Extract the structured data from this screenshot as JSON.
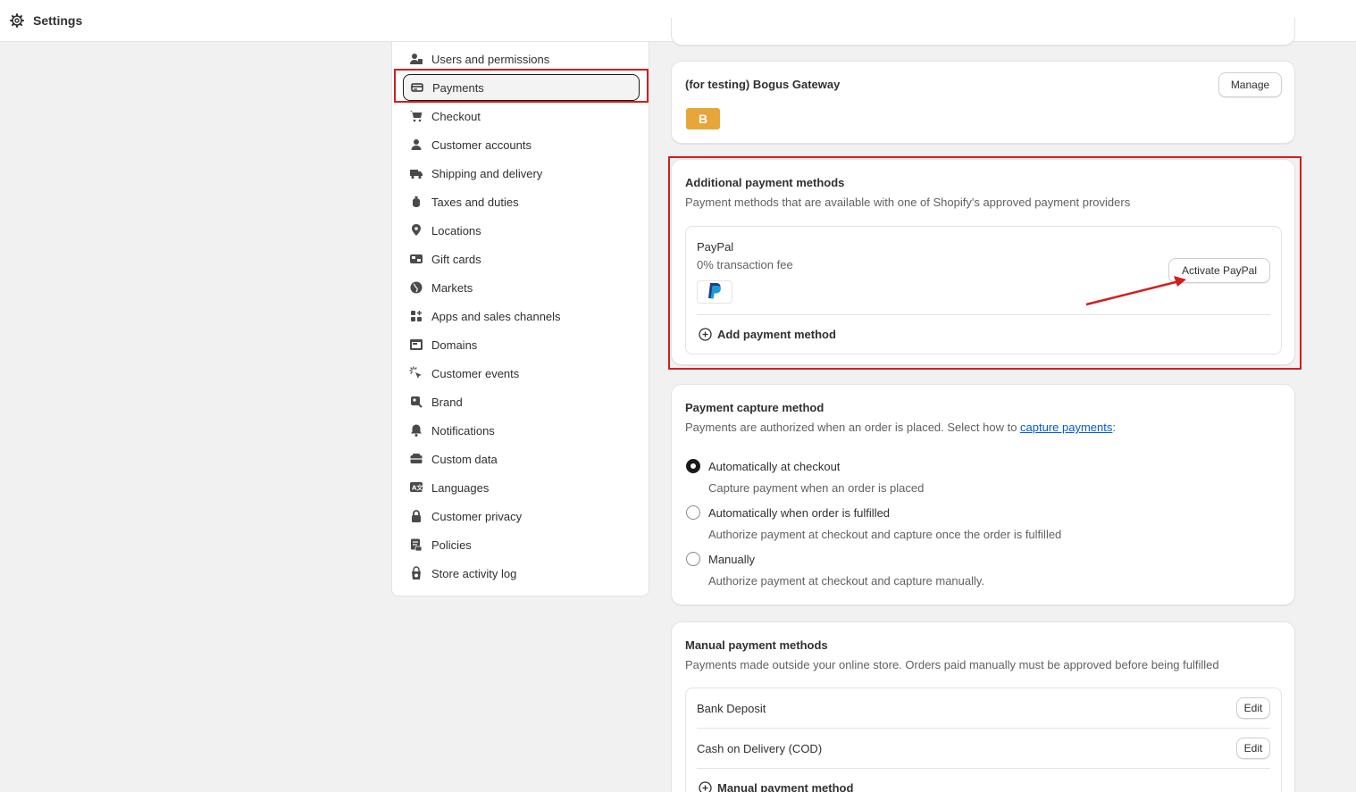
{
  "header": {
    "title": "Settings",
    "icon": "gear-icon"
  },
  "sidebar": {
    "items": [
      {
        "label": "Users and permissions",
        "icon": "users-icon"
      },
      {
        "label": "Payments",
        "icon": "payments-icon",
        "active": true
      },
      {
        "label": "Checkout",
        "icon": "cart-icon"
      },
      {
        "label": "Customer accounts",
        "icon": "person-icon"
      },
      {
        "label": "Shipping and delivery",
        "icon": "truck-icon"
      },
      {
        "label": "Taxes and duties",
        "icon": "tax-bag-icon"
      },
      {
        "label": "Locations",
        "icon": "location-pin-icon"
      },
      {
        "label": "Gift cards",
        "icon": "gift-card-icon"
      },
      {
        "label": "Markets",
        "icon": "globe-icon"
      },
      {
        "label": "Apps and sales channels",
        "icon": "apps-grid-icon"
      },
      {
        "label": "Domains",
        "icon": "domain-icon"
      },
      {
        "label": "Customer events",
        "icon": "cursor-click-icon"
      },
      {
        "label": "Brand",
        "icon": "brand-icon"
      },
      {
        "label": "Notifications",
        "icon": "bell-icon"
      },
      {
        "label": "Custom data",
        "icon": "database-icon"
      },
      {
        "label": "Languages",
        "icon": "language-icon"
      },
      {
        "label": "Customer privacy",
        "icon": "lock-icon"
      },
      {
        "label": "Policies",
        "icon": "policy-icon"
      },
      {
        "label": "Store activity log",
        "icon": "activity-log-icon"
      }
    ]
  },
  "bogus": {
    "title": "(for testing) Bogus Gateway",
    "manage_label": "Manage",
    "badge": "B",
    "badge_color": "#e6a63a"
  },
  "additional": {
    "title": "Additional payment methods",
    "subtitle": "Payment methods that are available with one of Shopify's approved payment providers",
    "paypal_name": "PayPal",
    "paypal_fee": "0% transaction fee",
    "activate_label": "Activate PayPal",
    "add_label": "Add payment method"
  },
  "capture": {
    "title": "Payment capture method",
    "subtitle_prefix": "Payments are authorized when an order is placed. Select how to ",
    "subtitle_link": "capture payments",
    "subtitle_suffix": ":",
    "options": [
      {
        "label": "Automatically at checkout",
        "desc": "Capture payment when an order is placed",
        "checked": true
      },
      {
        "label": "Automatically when order is fulfilled",
        "desc": "Authorize payment at checkout and capture once the order is fulfilled",
        "checked": false
      },
      {
        "label": "Manually",
        "desc": "Authorize payment at checkout and capture manually.",
        "checked": false
      }
    ]
  },
  "manual": {
    "title": "Manual payment methods",
    "subtitle": "Payments made outside your online store. Orders paid manually must be approved before being fulfilled",
    "methods": [
      {
        "label": "Bank Deposit",
        "edit_label": "Edit"
      },
      {
        "label": "Cash on Delivery (COD)",
        "edit_label": "Edit"
      }
    ],
    "add_label": "Manual payment method"
  },
  "colors": {
    "highlight": "#d31d1d",
    "link": "#005bd3"
  }
}
